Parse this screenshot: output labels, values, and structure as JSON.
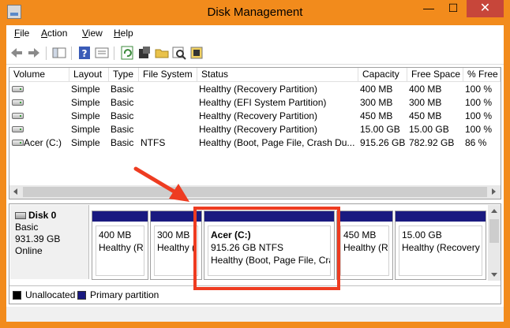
{
  "window": {
    "title": "Disk Management",
    "controls": {
      "minimize": "—",
      "maximize": "☐",
      "close": "✕"
    }
  },
  "menu": [
    {
      "key": "F",
      "rest": "ile"
    },
    {
      "key": "A",
      "rest": "ction"
    },
    {
      "key": "V",
      "rest": "iew"
    },
    {
      "key": "H",
      "rest": "elp"
    }
  ],
  "toolbar": {
    "icons": [
      "back-icon",
      "forward-icon",
      "show-hide-tree-icon",
      "help-icon",
      "properties-icon",
      "refresh-icon",
      "settings-icon",
      "open-folder-icon",
      "rescan-disks-icon",
      "export-list-icon"
    ]
  },
  "volumes": {
    "columns": [
      "Volume",
      "Layout",
      "Type",
      "File System",
      "Status",
      "Capacity",
      "Free Space",
      "% Free"
    ],
    "rows": [
      {
        "volume": "",
        "layout": "Simple",
        "type": "Basic",
        "fs": "",
        "status": "Healthy (Recovery Partition)",
        "capacity": "400 MB",
        "free": "400 MB",
        "pct": "100 %"
      },
      {
        "volume": "",
        "layout": "Simple",
        "type": "Basic",
        "fs": "",
        "status": "Healthy (EFI System Partition)",
        "capacity": "300 MB",
        "free": "300 MB",
        "pct": "100 %"
      },
      {
        "volume": "",
        "layout": "Simple",
        "type": "Basic",
        "fs": "",
        "status": "Healthy (Recovery Partition)",
        "capacity": "450 MB",
        "free": "450 MB",
        "pct": "100 %"
      },
      {
        "volume": "",
        "layout": "Simple",
        "type": "Basic",
        "fs": "",
        "status": "Healthy (Recovery Partition)",
        "capacity": "15.00 GB",
        "free": "15.00 GB",
        "pct": "100 %"
      },
      {
        "volume": "Acer (C:)",
        "layout": "Simple",
        "type": "Basic",
        "fs": "NTFS",
        "status": "Healthy (Boot, Page File, Crash Du...",
        "capacity": "915.26 GB",
        "free": "782.92 GB",
        "pct": "86 %"
      }
    ]
  },
  "disk": {
    "name": "Disk 0",
    "type": "Basic",
    "size": "931.39 GB",
    "state": "Online",
    "partitions": [
      {
        "title": "",
        "size": "400 MB",
        "status": "Healthy (Re"
      },
      {
        "title": "",
        "size": "300 MB",
        "status": "Healthy ("
      },
      {
        "title": "Acer  (C:)",
        "size": "915.26 GB NTFS",
        "status": "Healthy (Boot, Page File, Cra"
      },
      {
        "title": "",
        "size": "450 MB",
        "status": "Healthy (Re"
      },
      {
        "title": "",
        "size": "15.00 GB",
        "status": "Healthy (Recovery P"
      }
    ]
  },
  "legend": [
    {
      "label": "Unallocated",
      "color": "#000000"
    },
    {
      "label": "Primary partition",
      "color": "#1a1a80"
    }
  ],
  "colors": {
    "window_frame": "#f28b1c",
    "close_button": "#c7463a",
    "partition_header": "#1a1a80",
    "annotation": "#ee3c21"
  }
}
